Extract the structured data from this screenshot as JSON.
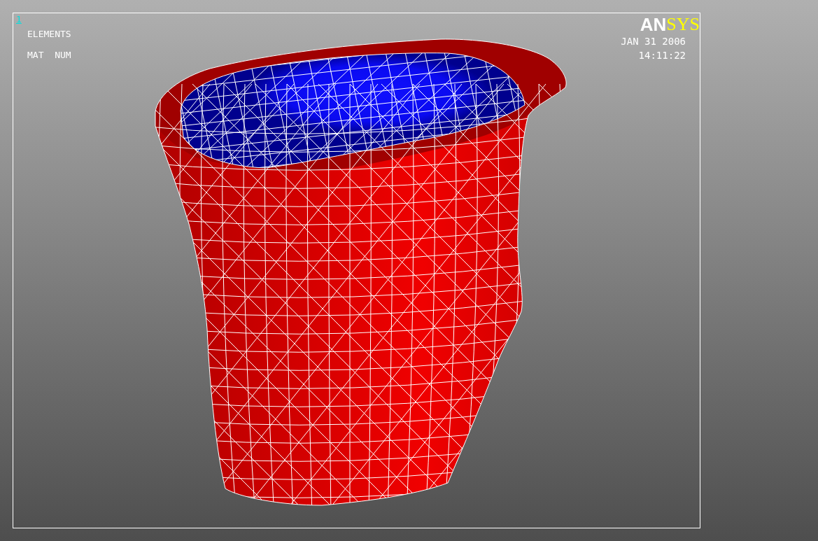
{
  "viewport": {
    "window_number": "1",
    "legend": [
      "ELEMENTS",
      "MAT  NUM"
    ],
    "logo": {
      "first": "AN",
      "second": "SYS"
    },
    "date": "JAN 31 2006",
    "time": "14:11:22"
  }
}
